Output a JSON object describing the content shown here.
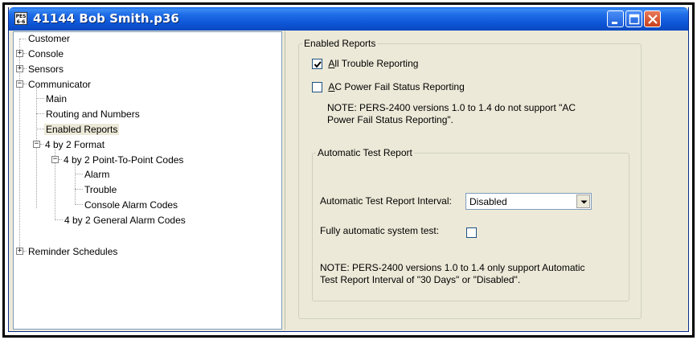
{
  "window": {
    "title": "41144 Bob Smith.p36",
    "icon_text": "PES 6·6"
  },
  "tree": {
    "items": [
      {
        "label": "Customer"
      },
      {
        "label": "Console",
        "expander": "+"
      },
      {
        "label": "Sensors",
        "expander": "+"
      },
      {
        "label": "Communicator",
        "expander": "−"
      },
      {
        "label": "Main"
      },
      {
        "label": "Routing and Numbers"
      },
      {
        "label": "Enabled Reports",
        "selected": true
      },
      {
        "label": "4 by 2 Format",
        "expander": "−"
      },
      {
        "label": "4 by 2 Point-To-Point Codes",
        "expander": "−"
      },
      {
        "label": "Alarm"
      },
      {
        "label": "Trouble"
      },
      {
        "label": "Console Alarm Codes"
      },
      {
        "label": "4 by 2 General Alarm Codes"
      },
      {
        "label": "Reminder Schedules",
        "expander": "+"
      }
    ]
  },
  "enabled_reports": {
    "group_label": "Enabled Reports",
    "all_trouble": {
      "label_u": "A",
      "label_rest": "ll Trouble Reporting",
      "checked": true
    },
    "ac_power": {
      "label_u": "A",
      "label_rest": "C Power Fail Status Reporting",
      "checked": false
    },
    "note_line1": "NOTE: PERS-2400 versions 1.0 to 1.4 do not support \"AC",
    "note_line2": "Power Fail Status Reporting\"."
  },
  "auto_test": {
    "group_label": "Automatic Test Report",
    "interval_label": "Automatic Test Report Interval:",
    "interval_value": "Disabled",
    "fully_auto_label": "Fully automatic system test:",
    "fully_auto_checked": false,
    "note_line1": "NOTE: PERS-2400 versions 1.0 to 1.4 only support Automatic",
    "note_line2": "Test Report Interval of \"30 Days\" or \"Disabled\"."
  },
  "colors": {
    "titlebar": "#0d55d6",
    "close": "#c8401c",
    "panel": "#ece9d8"
  }
}
